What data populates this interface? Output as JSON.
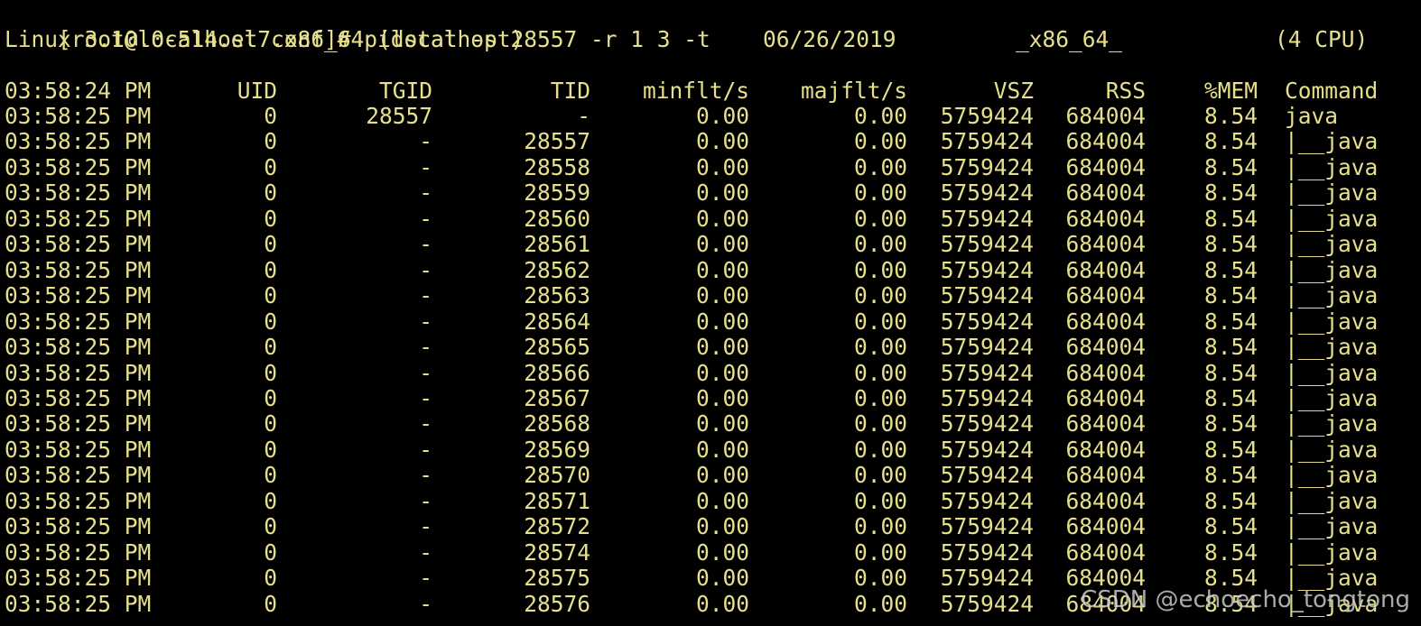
{
  "terminal": {
    "prompt_line": "[root@localhost conf]# pidstat -p 28557 -r 1 3 -t",
    "sysinfo": {
      "kernel": "Linux 3.10.0-514.el7.x86_64 (localhost)",
      "date": "06/26/2019",
      "arch": "_x86_64_",
      "cpus": "(4 CPU)"
    },
    "columns": {
      "time": "03:58:24 PM",
      "uid": "UID",
      "tgid": "TGID",
      "tid": "TID",
      "minflt": "minflt/s",
      "majflt": "majflt/s",
      "vsz": "VSZ",
      "rss": "RSS",
      "mem": "%MEM",
      "command": "Command"
    },
    "rows": [
      {
        "time": "03:58:25 PM",
        "uid": "0",
        "tgid": "28557",
        "tid": "-",
        "minflt": "0.00",
        "majflt": "0.00",
        "vsz": "5759424",
        "rss": "684004",
        "mem": "8.54",
        "command": "java"
      },
      {
        "time": "03:58:25 PM",
        "uid": "0",
        "tgid": "-",
        "tid": "28557",
        "minflt": "0.00",
        "majflt": "0.00",
        "vsz": "5759424",
        "rss": "684004",
        "mem": "8.54",
        "command": "|__java"
      },
      {
        "time": "03:58:25 PM",
        "uid": "0",
        "tgid": "-",
        "tid": "28558",
        "minflt": "0.00",
        "majflt": "0.00",
        "vsz": "5759424",
        "rss": "684004",
        "mem": "8.54",
        "command": "|__java"
      },
      {
        "time": "03:58:25 PM",
        "uid": "0",
        "tgid": "-",
        "tid": "28559",
        "minflt": "0.00",
        "majflt": "0.00",
        "vsz": "5759424",
        "rss": "684004",
        "mem": "8.54",
        "command": "|__java"
      },
      {
        "time": "03:58:25 PM",
        "uid": "0",
        "tgid": "-",
        "tid": "28560",
        "minflt": "0.00",
        "majflt": "0.00",
        "vsz": "5759424",
        "rss": "684004",
        "mem": "8.54",
        "command": "|__java"
      },
      {
        "time": "03:58:25 PM",
        "uid": "0",
        "tgid": "-",
        "tid": "28561",
        "minflt": "0.00",
        "majflt": "0.00",
        "vsz": "5759424",
        "rss": "684004",
        "mem": "8.54",
        "command": "|__java"
      },
      {
        "time": "03:58:25 PM",
        "uid": "0",
        "tgid": "-",
        "tid": "28562",
        "minflt": "0.00",
        "majflt": "0.00",
        "vsz": "5759424",
        "rss": "684004",
        "mem": "8.54",
        "command": "|__java"
      },
      {
        "time": "03:58:25 PM",
        "uid": "0",
        "tgid": "-",
        "tid": "28563",
        "minflt": "0.00",
        "majflt": "0.00",
        "vsz": "5759424",
        "rss": "684004",
        "mem": "8.54",
        "command": "|__java"
      },
      {
        "time": "03:58:25 PM",
        "uid": "0",
        "tgid": "-",
        "tid": "28564",
        "minflt": "0.00",
        "majflt": "0.00",
        "vsz": "5759424",
        "rss": "684004",
        "mem": "8.54",
        "command": "|__java"
      },
      {
        "time": "03:58:25 PM",
        "uid": "0",
        "tgid": "-",
        "tid": "28565",
        "minflt": "0.00",
        "majflt": "0.00",
        "vsz": "5759424",
        "rss": "684004",
        "mem": "8.54",
        "command": "|__java"
      },
      {
        "time": "03:58:25 PM",
        "uid": "0",
        "tgid": "-",
        "tid": "28566",
        "minflt": "0.00",
        "majflt": "0.00",
        "vsz": "5759424",
        "rss": "684004",
        "mem": "8.54",
        "command": "|__java"
      },
      {
        "time": "03:58:25 PM",
        "uid": "0",
        "tgid": "-",
        "tid": "28567",
        "minflt": "0.00",
        "majflt": "0.00",
        "vsz": "5759424",
        "rss": "684004",
        "mem": "8.54",
        "command": "|__java"
      },
      {
        "time": "03:58:25 PM",
        "uid": "0",
        "tgid": "-",
        "tid": "28568",
        "minflt": "0.00",
        "majflt": "0.00",
        "vsz": "5759424",
        "rss": "684004",
        "mem": "8.54",
        "command": "|__java"
      },
      {
        "time": "03:58:25 PM",
        "uid": "0",
        "tgid": "-",
        "tid": "28569",
        "minflt": "0.00",
        "majflt": "0.00",
        "vsz": "5759424",
        "rss": "684004",
        "mem": "8.54",
        "command": "|__java"
      },
      {
        "time": "03:58:25 PM",
        "uid": "0",
        "tgid": "-",
        "tid": "28570",
        "minflt": "0.00",
        "majflt": "0.00",
        "vsz": "5759424",
        "rss": "684004",
        "mem": "8.54",
        "command": "|__java"
      },
      {
        "time": "03:58:25 PM",
        "uid": "0",
        "tgid": "-",
        "tid": "28571",
        "minflt": "0.00",
        "majflt": "0.00",
        "vsz": "5759424",
        "rss": "684004",
        "mem": "8.54",
        "command": "|__java"
      },
      {
        "time": "03:58:25 PM",
        "uid": "0",
        "tgid": "-",
        "tid": "28572",
        "minflt": "0.00",
        "majflt": "0.00",
        "vsz": "5759424",
        "rss": "684004",
        "mem": "8.54",
        "command": "|__java"
      },
      {
        "time": "03:58:25 PM",
        "uid": "0",
        "tgid": "-",
        "tid": "28574",
        "minflt": "0.00",
        "majflt": "0.00",
        "vsz": "5759424",
        "rss": "684004",
        "mem": "8.54",
        "command": "|__java"
      },
      {
        "time": "03:58:25 PM",
        "uid": "0",
        "tgid": "-",
        "tid": "28575",
        "minflt": "0.00",
        "majflt": "0.00",
        "vsz": "5759424",
        "rss": "684004",
        "mem": "8.54",
        "command": "|__java"
      },
      {
        "time": "03:58:25 PM",
        "uid": "0",
        "tgid": "-",
        "tid": "28576",
        "minflt": "0.00",
        "majflt": "0.00",
        "vsz": "5759424",
        "rss": "684004",
        "mem": "8.54",
        "command": "|__java"
      }
    ]
  },
  "watermark": "CSDN @echoecho_tongtong",
  "colors": {
    "background": "#000000",
    "text": "#e6e08a"
  }
}
